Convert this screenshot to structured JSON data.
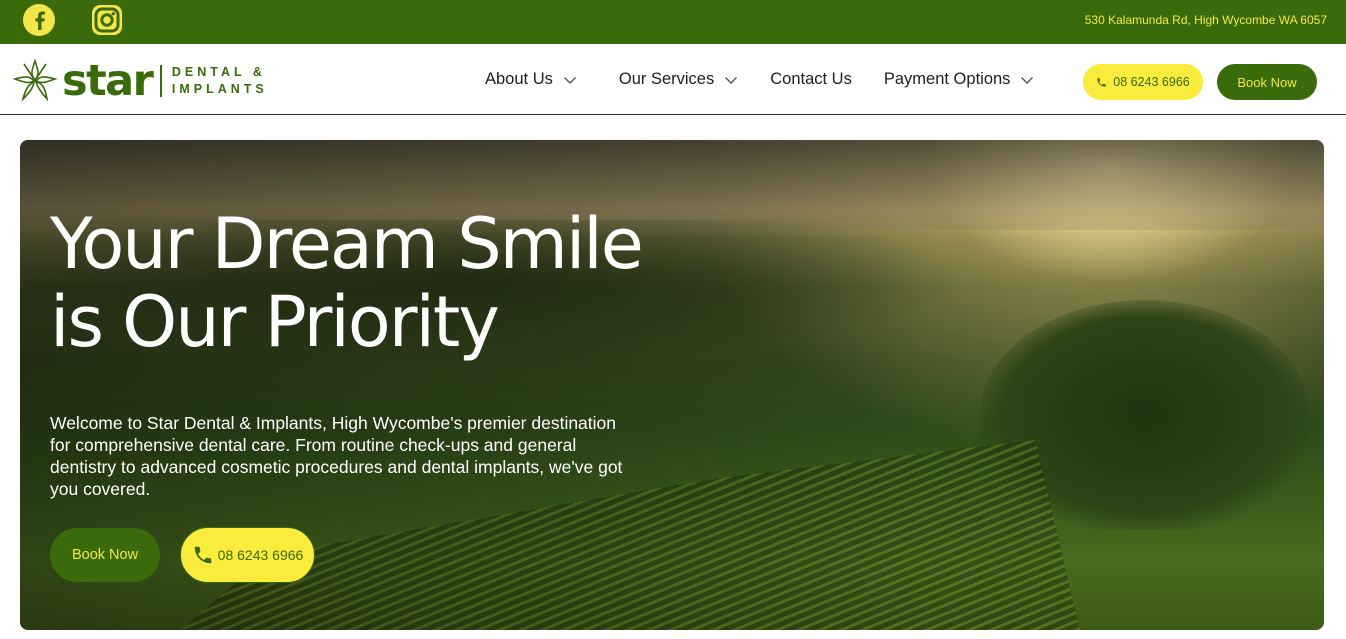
{
  "topbar": {
    "address": "530 Kalamunda Rd, High Wycombe WA 6057",
    "social": [
      "facebook-icon",
      "instagram-icon"
    ],
    "bg_color": "#3a6b0a",
    "accent_color": "#f4e64a"
  },
  "header": {
    "logo": {
      "word": "star",
      "line1": "DENTAL &",
      "line2": "IMPLANTS"
    },
    "nav": [
      {
        "label": "About Us",
        "has_dropdown": true
      },
      {
        "label": "Our Services",
        "has_dropdown": true
      },
      {
        "label": "Contact Us",
        "has_dropdown": false
      },
      {
        "label": "Payment Options",
        "has_dropdown": true
      }
    ],
    "phone": "08 6243 6966",
    "book": "Book Now"
  },
  "hero": {
    "title_line1": "Your Dream Smile",
    "title_line2": "is Our Priority",
    "text": "Welcome to Star Dental & Implants, High Wycombe's premier destination for comprehensive dental care. From routine check-ups and general dentistry to advanced cosmetic procedures and dental implants, we've got you covered.",
    "book": "Book Now",
    "phone": "08 6243 6966"
  }
}
